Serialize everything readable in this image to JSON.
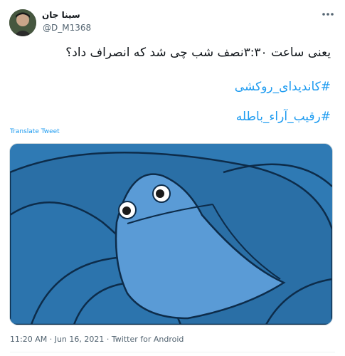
{
  "author": {
    "display_name": "سینا جان",
    "handle": "@D_M1368"
  },
  "tweet": {
    "text": "یعنی ساعت ۳:۳۰نصف شب چی شد که انصراف داد؟",
    "hashtags": [
      "#کاندیدای_روکشی",
      "#رقیب_آراء_باطله"
    ],
    "translate_label": "Translate Tweet"
  },
  "media": {
    "description_icon": "cartoon-character-under-blanket",
    "colors": {
      "background": "#2f7ab4",
      "character": "#5a9bd6",
      "outline": "#0d2c4a"
    }
  },
  "meta": {
    "time": "11:20 AM",
    "separator1": " · ",
    "date": "Jun 16, 2021",
    "separator2": " · ",
    "source": "Twitter for Android"
  },
  "icons": {
    "more": "more-options-icon"
  }
}
